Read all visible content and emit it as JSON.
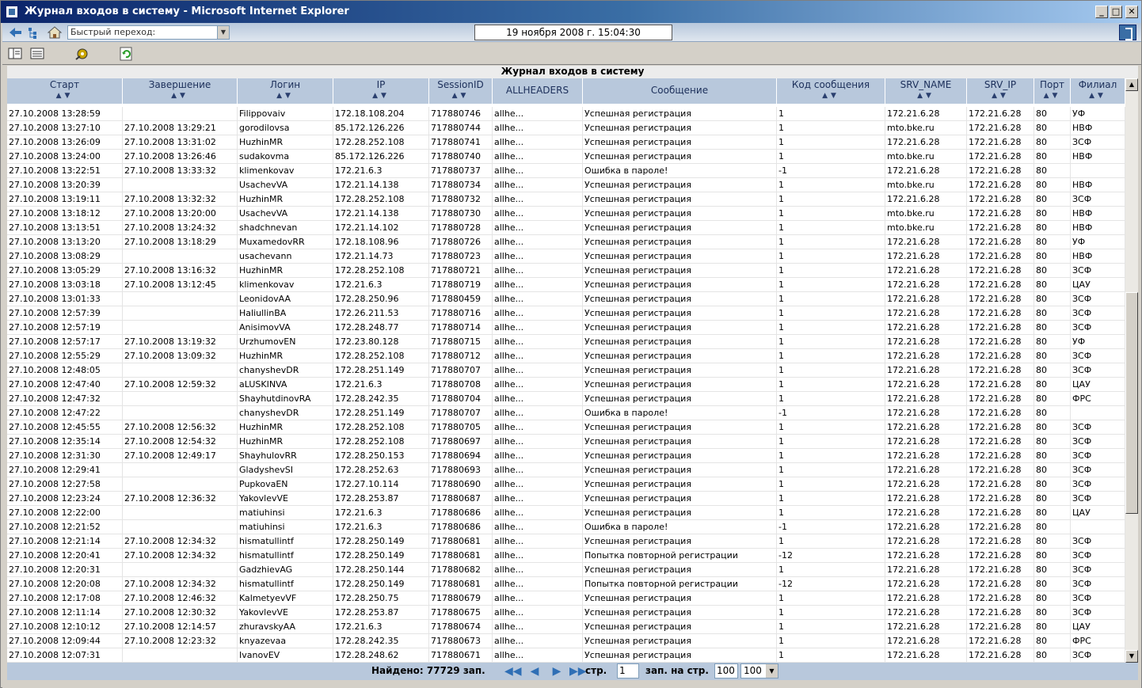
{
  "window": {
    "title": "Журнал входов в систему - Microsoft Internet Explorer",
    "minimize": "_",
    "maximize": "□",
    "close": "✕"
  },
  "addressbar": {
    "quick_nav_placeholder": "Быстрый переход:",
    "datetime": "19 ноября 2008 г. 15:04:30",
    "dropdown_glyph": "▼"
  },
  "grid": {
    "caption": "Журнал входов в систему",
    "sort_glyph": "▲▼",
    "columns": [
      {
        "label": "Старт"
      },
      {
        "label": "Завершение"
      },
      {
        "label": "Логин"
      },
      {
        "label": "IP"
      },
      {
        "label": "SessionID"
      },
      {
        "label": "ALLHEADERS"
      },
      {
        "label": "Сообщение"
      },
      {
        "label": "Код сообщения"
      },
      {
        "label": "SRV_NAME"
      },
      {
        "label": "SRV_IP"
      },
      {
        "label": "Порт"
      },
      {
        "label": "Филиал"
      }
    ],
    "rows": [
      [
        "27.10.2008 13:28:59",
        "",
        "Filippovaiv",
        "172.18.108.204",
        "717880746",
        "allhe...",
        "Успешная регистрация",
        "1",
        "172.21.6.28",
        "172.21.6.28",
        "80",
        "УФ"
      ],
      [
        "27.10.2008 13:27:10",
        "27.10.2008 13:29:21",
        "gorodilovsa",
        "85.172.126.226",
        "717880744",
        "allhe...",
        "Успешная регистрация",
        "1",
        "mto.bke.ru",
        "172.21.6.28",
        "80",
        "НВФ"
      ],
      [
        "27.10.2008 13:26:09",
        "27.10.2008 13:31:02",
        "HuzhinMR",
        "172.28.252.108",
        "717880741",
        "allhe...",
        "Успешная регистрация",
        "1",
        "172.21.6.28",
        "172.21.6.28",
        "80",
        "ЗСФ"
      ],
      [
        "27.10.2008 13:24:00",
        "27.10.2008 13:26:46",
        "sudakovma",
        "85.172.126.226",
        "717880740",
        "allhe...",
        "Успешная регистрация",
        "1",
        "mto.bke.ru",
        "172.21.6.28",
        "80",
        "НВФ"
      ],
      [
        "27.10.2008 13:22:51",
        "27.10.2008 13:33:32",
        "klimenkovav",
        "172.21.6.3",
        "717880737",
        "allhe...",
        "Ошибка в пароле!",
        "-1",
        "172.21.6.28",
        "172.21.6.28",
        "80",
        ""
      ],
      [
        "27.10.2008 13:20:39",
        "",
        "UsachevVA",
        "172.21.14.138",
        "717880734",
        "allhe...",
        "Успешная регистрация",
        "1",
        "mto.bke.ru",
        "172.21.6.28",
        "80",
        "НВФ"
      ],
      [
        "27.10.2008 13:19:11",
        "27.10.2008 13:32:32",
        "HuzhinMR",
        "172.28.252.108",
        "717880732",
        "allhe...",
        "Успешная регистрация",
        "1",
        "172.21.6.28",
        "172.21.6.28",
        "80",
        "ЗСФ"
      ],
      [
        "27.10.2008 13:18:12",
        "27.10.2008 13:20:00",
        "UsachevVA",
        "172.21.14.138",
        "717880730",
        "allhe...",
        "Успешная регистрация",
        "1",
        "mto.bke.ru",
        "172.21.6.28",
        "80",
        "НВФ"
      ],
      [
        "27.10.2008 13:13:51",
        "27.10.2008 13:24:32",
        "shadchnevan",
        "172.21.14.102",
        "717880728",
        "allhe...",
        "Успешная регистрация",
        "1",
        "mto.bke.ru",
        "172.21.6.28",
        "80",
        "НВФ"
      ],
      [
        "27.10.2008 13:13:20",
        "27.10.2008 13:18:29",
        "MuxamedovRR",
        "172.18.108.96",
        "717880726",
        "allhe...",
        "Успешная регистрация",
        "1",
        "172.21.6.28",
        "172.21.6.28",
        "80",
        "УФ"
      ],
      [
        "27.10.2008 13:08:29",
        "",
        "usachevann",
        "172.21.14.73",
        "717880723",
        "allhe...",
        "Успешная регистрация",
        "1",
        "172.21.6.28",
        "172.21.6.28",
        "80",
        "НВФ"
      ],
      [
        "27.10.2008 13:05:29",
        "27.10.2008 13:16:32",
        "HuzhinMR",
        "172.28.252.108",
        "717880721",
        "allhe...",
        "Успешная регистрация",
        "1",
        "172.21.6.28",
        "172.21.6.28",
        "80",
        "ЗСФ"
      ],
      [
        "27.10.2008 13:03:18",
        "27.10.2008 13:12:45",
        "klimenkovav",
        "172.21.6.3",
        "717880719",
        "allhe...",
        "Успешная регистрация",
        "1",
        "172.21.6.28",
        "172.21.6.28",
        "80",
        "ЦАУ"
      ],
      [
        "27.10.2008 13:01:33",
        "",
        "LeonidovAA",
        "172.28.250.96",
        "717880459",
        "allhe...",
        "Успешная регистрация",
        "1",
        "172.21.6.28",
        "172.21.6.28",
        "80",
        "ЗСФ"
      ],
      [
        "27.10.2008 12:57:39",
        "",
        "HaliullinBA",
        "172.26.211.53",
        "717880716",
        "allhe...",
        "Успешная регистрация",
        "1",
        "172.21.6.28",
        "172.21.6.28",
        "80",
        "ЗСФ"
      ],
      [
        "27.10.2008 12:57:19",
        "",
        "AnisimovVA",
        "172.28.248.77",
        "717880714",
        "allhe...",
        "Успешная регистрация",
        "1",
        "172.21.6.28",
        "172.21.6.28",
        "80",
        "ЗСФ"
      ],
      [
        "27.10.2008 12:57:17",
        "27.10.2008 13:19:32",
        "UrzhumovEN",
        "172.23.80.128",
        "717880715",
        "allhe...",
        "Успешная регистрация",
        "1",
        "172.21.6.28",
        "172.21.6.28",
        "80",
        "УФ"
      ],
      [
        "27.10.2008 12:55:29",
        "27.10.2008 13:09:32",
        "HuzhinMR",
        "172.28.252.108",
        "717880712",
        "allhe...",
        "Успешная регистрация",
        "1",
        "172.21.6.28",
        "172.21.6.28",
        "80",
        "ЗСФ"
      ],
      [
        "27.10.2008 12:48:05",
        "",
        "chanyshevDR",
        "172.28.251.149",
        "717880707",
        "allhe...",
        "Успешная регистрация",
        "1",
        "172.21.6.28",
        "172.21.6.28",
        "80",
        "ЗСФ"
      ],
      [
        "27.10.2008 12:47:40",
        "27.10.2008 12:59:32",
        "aLUSKINVA",
        "172.21.6.3",
        "717880708",
        "allhe...",
        "Успешная регистрация",
        "1",
        "172.21.6.28",
        "172.21.6.28",
        "80",
        "ЦАУ"
      ],
      [
        "27.10.2008 12:47:32",
        "",
        "ShayhutdinovRA",
        "172.28.242.35",
        "717880704",
        "allhe...",
        "Успешная регистрация",
        "1",
        "172.21.6.28",
        "172.21.6.28",
        "80",
        "ФРС"
      ],
      [
        "27.10.2008 12:47:22",
        "",
        "chanyshevDR",
        "172.28.251.149",
        "717880707",
        "allhe...",
        "Ошибка в пароле!",
        "-1",
        "172.21.6.28",
        "172.21.6.28",
        "80",
        ""
      ],
      [
        "27.10.2008 12:45:55",
        "27.10.2008 12:56:32",
        "HuzhinMR",
        "172.28.252.108",
        "717880705",
        "allhe...",
        "Успешная регистрация",
        "1",
        "172.21.6.28",
        "172.21.6.28",
        "80",
        "ЗСФ"
      ],
      [
        "27.10.2008 12:35:14",
        "27.10.2008 12:54:32",
        "HuzhinMR",
        "172.28.252.108",
        "717880697",
        "allhe...",
        "Успешная регистрация",
        "1",
        "172.21.6.28",
        "172.21.6.28",
        "80",
        "ЗСФ"
      ],
      [
        "27.10.2008 12:31:30",
        "27.10.2008 12:49:17",
        "ShayhulovRR",
        "172.28.250.153",
        "717880694",
        "allhe...",
        "Успешная регистрация",
        "1",
        "172.21.6.28",
        "172.21.6.28",
        "80",
        "ЗСФ"
      ],
      [
        "27.10.2008 12:29:41",
        "",
        "GladyshevSI",
        "172.28.252.63",
        "717880693",
        "allhe...",
        "Успешная регистрация",
        "1",
        "172.21.6.28",
        "172.21.6.28",
        "80",
        "ЗСФ"
      ],
      [
        "27.10.2008 12:27:58",
        "",
        "PupkovaEN",
        "172.27.10.114",
        "717880690",
        "allhe...",
        "Успешная регистрация",
        "1",
        "172.21.6.28",
        "172.21.6.28",
        "80",
        "ЗСФ"
      ],
      [
        "27.10.2008 12:23:24",
        "27.10.2008 12:36:32",
        "YakovlevVE",
        "172.28.253.87",
        "717880687",
        "allhe...",
        "Успешная регистрация",
        "1",
        "172.21.6.28",
        "172.21.6.28",
        "80",
        "ЗСФ"
      ],
      [
        "27.10.2008 12:22:00",
        "",
        "matiuhinsi",
        "172.21.6.3",
        "717880686",
        "allhe...",
        "Успешная регистрация",
        "1",
        "172.21.6.28",
        "172.21.6.28",
        "80",
        "ЦАУ"
      ],
      [
        "27.10.2008 12:21:52",
        "",
        "matiuhinsi",
        "172.21.6.3",
        "717880686",
        "allhe...",
        "Ошибка в пароле!",
        "-1",
        "172.21.6.28",
        "172.21.6.28",
        "80",
        ""
      ],
      [
        "27.10.2008 12:21:14",
        "27.10.2008 12:34:32",
        "hismatullintf",
        "172.28.250.149",
        "717880681",
        "allhe...",
        "Успешная регистрация",
        "1",
        "172.21.6.28",
        "172.21.6.28",
        "80",
        "ЗСФ"
      ],
      [
        "27.10.2008 12:20:41",
        "27.10.2008 12:34:32",
        "hismatullintf",
        "172.28.250.149",
        "717880681",
        "allhe...",
        "Попытка повторной регистрации",
        "-12",
        "172.21.6.28",
        "172.21.6.28",
        "80",
        "ЗСФ"
      ],
      [
        "27.10.2008 12:20:31",
        "",
        "GadzhievAG",
        "172.28.250.144",
        "717880682",
        "allhe...",
        "Успешная регистрация",
        "1",
        "172.21.6.28",
        "172.21.6.28",
        "80",
        "ЗСФ"
      ],
      [
        "27.10.2008 12:20:08",
        "27.10.2008 12:34:32",
        "hismatullintf",
        "172.28.250.149",
        "717880681",
        "allhe...",
        "Попытка повторной регистрации",
        "-12",
        "172.21.6.28",
        "172.21.6.28",
        "80",
        "ЗСФ"
      ],
      [
        "27.10.2008 12:17:08",
        "27.10.2008 12:46:32",
        "KalmetyevVF",
        "172.28.250.75",
        "717880679",
        "allhe...",
        "Успешная регистрация",
        "1",
        "172.21.6.28",
        "172.21.6.28",
        "80",
        "ЗСФ"
      ],
      [
        "27.10.2008 12:11:14",
        "27.10.2008 12:30:32",
        "YakovlevVE",
        "172.28.253.87",
        "717880675",
        "allhe...",
        "Успешная регистрация",
        "1",
        "172.21.6.28",
        "172.21.6.28",
        "80",
        "ЗСФ"
      ],
      [
        "27.10.2008 12:10:12",
        "27.10.2008 12:14:57",
        "zhuravskyAA",
        "172.21.6.3",
        "717880674",
        "allhe...",
        "Успешная регистрация",
        "1",
        "172.21.6.28",
        "172.21.6.28",
        "80",
        "ЦАУ"
      ],
      [
        "27.10.2008 12:09:44",
        "27.10.2008 12:23:32",
        "knyazevaa",
        "172.28.242.35",
        "717880673",
        "allhe...",
        "Успешная регистрация",
        "1",
        "172.21.6.28",
        "172.21.6.28",
        "80",
        "ФРС"
      ],
      [
        "27.10.2008 12:07:31",
        "",
        "IvanovEV",
        "172.28.248.62",
        "717880671",
        "allhe...",
        "Успешная регистрация",
        "1",
        "172.21.6.28",
        "172.21.6.28",
        "80",
        "ЗСФ"
      ]
    ]
  },
  "pager": {
    "found": "Найдено: 77729 зап.",
    "first": "◀◀",
    "prev": "◀",
    "next": "▶",
    "last": "▶▶",
    "page_label": "стр.",
    "page_value": "1",
    "per_page_label": "зап. на стр.",
    "per_page_value": "100",
    "per_page_selected": "100"
  },
  "scrollbar": {
    "up": "▲",
    "down": "▼"
  }
}
